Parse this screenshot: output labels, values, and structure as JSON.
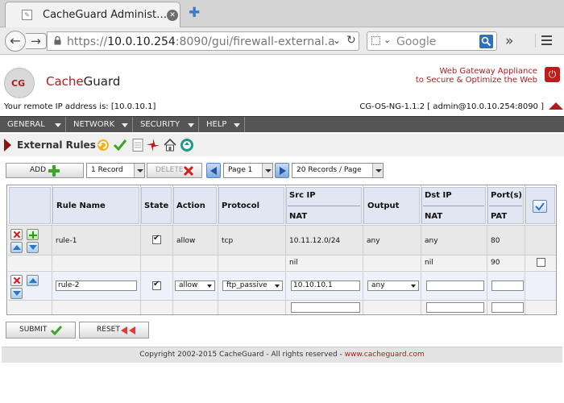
{
  "browser": {
    "tab_title": "CacheGuard Administ…",
    "url_prefix": "https://",
    "url_host": "10.0.10.254",
    "url_rest": ":8090/gui/firewall-external.a",
    "search_placeholder": "Google"
  },
  "header": {
    "brand_cache": "Cache",
    "brand_guard": "Guard",
    "logo_text": "CG",
    "tagline_line1": "Web Gateway Appliance",
    "tagline_line2": "to Secure & Optimize the Web",
    "remote_ip": "Your remote IP address is: [10.0.10.1]",
    "session": "CG-OS-NG-1.1.2 [ admin@10.0.10.254:8090 ]"
  },
  "menu": {
    "items": [
      {
        "label": "GENERAL"
      },
      {
        "label": "NETWORK"
      },
      {
        "label": "SECURITY"
      },
      {
        "label": "HELP"
      }
    ]
  },
  "page": {
    "title": "External Rules"
  },
  "toolbar": {
    "add_label": "ADD",
    "records_select": "1 Record",
    "delete_label": "DELETE",
    "page_select": "Page 1",
    "per_page_select": "20 Records / Page"
  },
  "table": {
    "headers": {
      "rule_name": "Rule Name",
      "state": "State",
      "action": "Action",
      "protocol": "Protocol",
      "src_ip": "Src IP",
      "nat": "NAT",
      "output": "Output",
      "dst_ip": "Dst IP",
      "dst_nat": "NAT",
      "ports": "Port(s)",
      "pat": "PAT"
    },
    "rows": [
      {
        "rule_name": "rule-1",
        "state": true,
        "action": "allow",
        "protocol": "tcp",
        "src_ip": "10.11.12.0/24",
        "output": "any",
        "dst_ip": "any",
        "ports": "80",
        "src_nat": "nil",
        "dst_nat": "nil",
        "pat": "90"
      },
      {
        "rule_name": "rule-2",
        "state": true,
        "action": "allow",
        "protocol": "ftp_passive",
        "src_ip": "10.10.10.1",
        "output": "any",
        "dst_ip": "",
        "ports": "",
        "src_nat": "",
        "dst_nat": "",
        "pat": ""
      }
    ]
  },
  "form": {
    "submit_label": "SUBMIT",
    "reset_label": "RESET"
  },
  "footer": {
    "copyright": "Copyright 2002-2015 CacheGuard - All rights reserved - ",
    "link": "www.cacheguard.com"
  },
  "colors": {
    "brand_red": "#b01c1c",
    "menubar": "#555555",
    "header_cell": "#e2e6f3",
    "row_highlight": "#eef0fa"
  }
}
